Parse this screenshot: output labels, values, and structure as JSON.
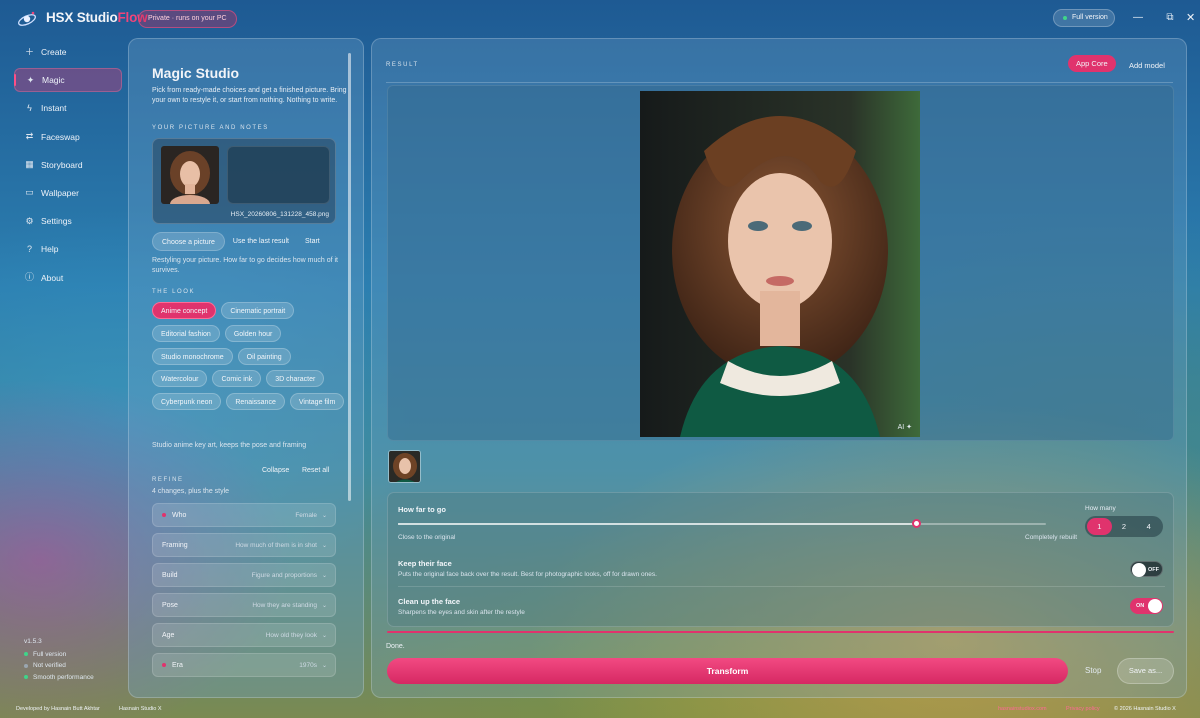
{
  "app": {
    "brand_main": "HSX Studio",
    "brand_accent": "Flow",
    "private_badge": "Private · runs on your PC",
    "version_pill": "Full version",
    "accent_color": "#e0336d"
  },
  "window_controls": {
    "minimize": "—",
    "maximize": "⧉",
    "close": "✕"
  },
  "sidebar": {
    "items": [
      {
        "label": "Create",
        "icon": "plus-icon"
      },
      {
        "label": "Magic",
        "icon": "magic-wand-icon",
        "active": true
      },
      {
        "label": "Instant",
        "icon": "bolt-icon"
      },
      {
        "label": "Faceswap",
        "icon": "swap-icon"
      },
      {
        "label": "Storyboard",
        "icon": "grid-icon"
      },
      {
        "label": "Wallpaper",
        "icon": "monitor-icon"
      },
      {
        "label": "Settings",
        "icon": "gear-icon"
      },
      {
        "label": "Help",
        "icon": "help-icon"
      },
      {
        "label": "About",
        "icon": "info-icon"
      }
    ],
    "footer": {
      "version": "v1.5.3",
      "status": [
        {
          "text": "Full version",
          "color": "#3fd58a"
        },
        {
          "text": "Not verified",
          "color": "#9aa6b0"
        },
        {
          "text": "Smooth performance",
          "color": "#3fd58a"
        }
      ]
    }
  },
  "magic": {
    "title": "Magic Studio",
    "description": "Pick from ready-made choices and get a finished picture. Bring your own to restyle it, or start from nothing. Nothing to write.",
    "picture_section": "YOUR PICTURE AND NOTES",
    "filename": "HSX_20260806_131228_458.png",
    "buttons": {
      "choose": "Choose a picture",
      "last_result": "Use the last result",
      "start": "Start"
    },
    "hint": "Restyling your picture. How far to go decides how much of it survives.",
    "look_section": "THE LOOK",
    "looks": [
      {
        "label": "Anime concept",
        "selected": true
      },
      {
        "label": "Cinematic portrait"
      },
      {
        "label": "Editorial fashion"
      },
      {
        "label": "Golden hour"
      },
      {
        "label": "Studio monochrome"
      },
      {
        "label": "Oil painting"
      },
      {
        "label": "Watercolour"
      },
      {
        "label": "Comic ink"
      },
      {
        "label": "3D character"
      },
      {
        "label": "Cyberpunk neon"
      },
      {
        "label": "Renaissance"
      },
      {
        "label": "Vintage film"
      }
    ],
    "style_note": "Studio anime key art, keeps the pose and framing",
    "refine_section": "REFINE",
    "collapse": "Collapse",
    "reset_all": "Reset all",
    "refine_summary": "4 changes, plus the style",
    "refine_rows": [
      {
        "label": "Who",
        "value": "Female",
        "changed": true
      },
      {
        "label": "Framing",
        "value": "How much of them is in shot",
        "changed": false
      },
      {
        "label": "Build",
        "value": "Figure and proportions",
        "changed": false
      },
      {
        "label": "Pose",
        "value": "How they are standing",
        "changed": false
      },
      {
        "label": "Age",
        "value": "How old they look",
        "changed": false
      },
      {
        "label": "Era",
        "value": "1970s",
        "changed": true
      }
    ]
  },
  "result": {
    "section": "RESULT",
    "app_core": "App Core",
    "add_model": "Add model",
    "ai_badge": "AI ✦"
  },
  "controls": {
    "how_far_title": "How far to go",
    "how_far_min_label": "Close to the original",
    "how_far_max_label": "Completely rebuilt",
    "how_far_value": 0.8,
    "how_many_label": "How many",
    "how_many_options": [
      "1",
      "2",
      "4"
    ],
    "how_many_selected": "1",
    "keep_face_title": "Keep their face",
    "keep_face_sub": "Puts the original face back over the result. Best for photographic looks, off for drawn ones.",
    "keep_face_state": "OFF",
    "clean_face_title": "Clean up the face",
    "clean_face_sub": "Sharpens the eyes and skin after the restyle",
    "clean_face_state": "ON"
  },
  "status": {
    "text": "Done.",
    "progress": 1.0
  },
  "actions": {
    "transform": "Transform",
    "stop": "Stop",
    "save_as": "Save as..."
  },
  "footer": {
    "developer": "Developed by Hasnain Butt Akhtar",
    "studio": "Hasnain Studio X",
    "site": "hasnainstudiox.com",
    "privacy": "Privacy policy",
    "copyright": "© 2026 Hasnain Studio X"
  }
}
